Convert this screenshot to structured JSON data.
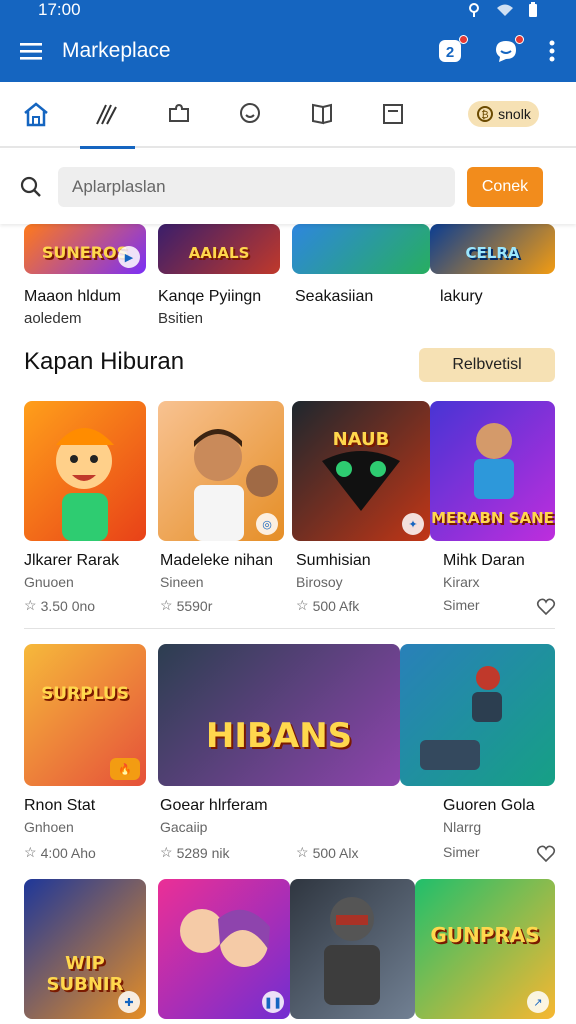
{
  "status": {
    "time": "17:00"
  },
  "appbar": {
    "title": "Markeplace",
    "notif_count": "2"
  },
  "tabs": {
    "pill_label": "snolk"
  },
  "search": {
    "placeholder": "Aplarplaslan",
    "button": "Conek"
  },
  "top_strip": [
    {
      "title": "Maaon hldum",
      "sub": "aoledem",
      "art_text": "SUNEROS",
      "colors": [
        "#ff7a1a",
        "#7b2ff7"
      ]
    },
    {
      "title": "Kanqe Pyiingn",
      "sub": "Bsitien",
      "art_text": "AAIALS",
      "colors": [
        "#3a1e6b",
        "#c0392b"
      ]
    },
    {
      "title": "Seakasiian",
      "sub": "",
      "art_text": "",
      "colors": [
        "#2e86de",
        "#27ae60"
      ]
    },
    {
      "title": "lakury",
      "sub": "",
      "art_text": "CELRA",
      "colors": [
        "#0b3d91",
        "#f39c12"
      ]
    }
  ],
  "section": {
    "title": "Kapan Hiburan",
    "button": "Relbvetisl"
  },
  "rows": [
    [
      {
        "title": "Jlkarer Rarak",
        "sub": "Gnuoen",
        "meta": "3.50 0no",
        "art_text": "",
        "colors": [
          "#ff9f1a",
          "#e84118"
        ]
      },
      {
        "title": "Madeleke nihan",
        "sub": "Sineen",
        "meta": "5590r",
        "art_text": "",
        "colors": [
          "#f8c291",
          "#e58e26"
        ]
      },
      {
        "title": "Sumhisian",
        "sub": "Birosoy",
        "meta": "500 Afk",
        "art_text": "NAUB",
        "colors": [
          "#1e272e",
          "#c23616"
        ]
      },
      {
        "title": "Mihk Daran",
        "sub": "Kirarx",
        "meta": "Simer",
        "art_text": "MERABN SANE",
        "colors": [
          "#4834d4",
          "#be2edd"
        ]
      }
    ],
    [
      {
        "title": "Rnon Stat",
        "sub": "Gnhoen",
        "meta": "4:00 Aho",
        "art_text": "SURPLUS",
        "colors": [
          "#f6b93b",
          "#e55039"
        ]
      },
      {
        "title": "Goear hlrferam",
        "sub": "Gacaiip",
        "meta": "5289 nik",
        "art_text": "HIBANS",
        "colors": [
          "#2c3e50",
          "#8e44ad"
        ]
      },
      {
        "title": "Guoren Gola",
        "sub": "Nlarrg",
        "meta": "500 Alx",
        "art_text": "",
        "colors": [
          "#2980b9",
          "#16a085"
        ]
      },
      {
        "title": "",
        "sub": "",
        "meta": "Simer",
        "art_text": "",
        "colors": [
          "#2980b9",
          "#16a085"
        ]
      }
    ],
    [
      {
        "title": "",
        "sub": "",
        "meta": "",
        "art_text": "WIP SUBNIR",
        "colors": [
          "#1e3799",
          "#e58e26"
        ]
      },
      {
        "title": "",
        "sub": "",
        "meta": "",
        "art_text": "",
        "colors": [
          "#eb2f96",
          "#722ed1"
        ]
      },
      {
        "title": "",
        "sub": "",
        "meta": "",
        "art_text": "",
        "colors": [
          "#2f3640",
          "#718093"
        ]
      },
      {
        "title": "",
        "sub": "",
        "meta": "",
        "art_text": "GUNPRAS",
        "colors": [
          "#20bf6b",
          "#f7b731"
        ]
      }
    ]
  ]
}
